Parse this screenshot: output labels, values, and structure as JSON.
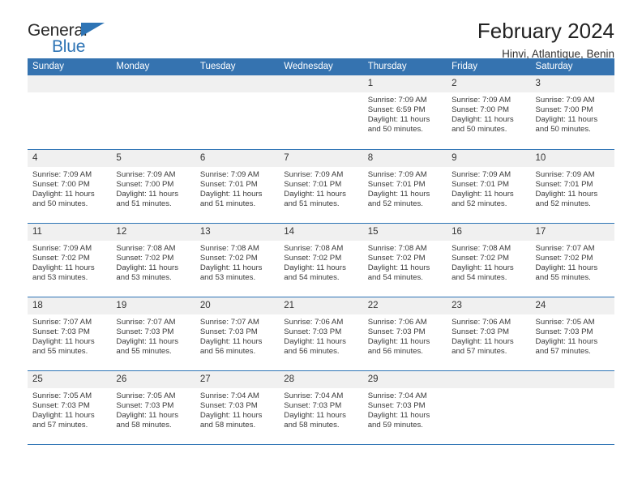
{
  "brand": {
    "name_dark": "General",
    "name_blue": "Blue",
    "accent_color": "#2e74b5"
  },
  "header": {
    "title": "February 2024",
    "location": "Hinvi, Atlantique, Benin",
    "header_bg": "#3573b0",
    "daynum_bg": "#f0f0f0"
  },
  "weekdays": [
    "Sunday",
    "Monday",
    "Tuesday",
    "Wednesday",
    "Thursday",
    "Friday",
    "Saturday"
  ],
  "labels": {
    "sunrise_prefix": "Sunrise:",
    "sunset_prefix": "Sunset:",
    "daylight_prefix": "Daylight:"
  },
  "weeks": [
    [
      {
        "day": ""
      },
      {
        "day": ""
      },
      {
        "day": ""
      },
      {
        "day": ""
      },
      {
        "day": "1",
        "sunrise": "Sunrise: 7:09 AM",
        "sunset": "Sunset: 6:59 PM",
        "daylight": "Daylight: 11 hours and 50 minutes."
      },
      {
        "day": "2",
        "sunrise": "Sunrise: 7:09 AM",
        "sunset": "Sunset: 7:00 PM",
        "daylight": "Daylight: 11 hours and 50 minutes."
      },
      {
        "day": "3",
        "sunrise": "Sunrise: 7:09 AM",
        "sunset": "Sunset: 7:00 PM",
        "daylight": "Daylight: 11 hours and 50 minutes."
      }
    ],
    [
      {
        "day": "4",
        "sunrise": "Sunrise: 7:09 AM",
        "sunset": "Sunset: 7:00 PM",
        "daylight": "Daylight: 11 hours and 50 minutes."
      },
      {
        "day": "5",
        "sunrise": "Sunrise: 7:09 AM",
        "sunset": "Sunset: 7:00 PM",
        "daylight": "Daylight: 11 hours and 51 minutes."
      },
      {
        "day": "6",
        "sunrise": "Sunrise: 7:09 AM",
        "sunset": "Sunset: 7:01 PM",
        "daylight": "Daylight: 11 hours and 51 minutes."
      },
      {
        "day": "7",
        "sunrise": "Sunrise: 7:09 AM",
        "sunset": "Sunset: 7:01 PM",
        "daylight": "Daylight: 11 hours and 51 minutes."
      },
      {
        "day": "8",
        "sunrise": "Sunrise: 7:09 AM",
        "sunset": "Sunset: 7:01 PM",
        "daylight": "Daylight: 11 hours and 52 minutes."
      },
      {
        "day": "9",
        "sunrise": "Sunrise: 7:09 AM",
        "sunset": "Sunset: 7:01 PM",
        "daylight": "Daylight: 11 hours and 52 minutes."
      },
      {
        "day": "10",
        "sunrise": "Sunrise: 7:09 AM",
        "sunset": "Sunset: 7:01 PM",
        "daylight": "Daylight: 11 hours and 52 minutes."
      }
    ],
    [
      {
        "day": "11",
        "sunrise": "Sunrise: 7:09 AM",
        "sunset": "Sunset: 7:02 PM",
        "daylight": "Daylight: 11 hours and 53 minutes."
      },
      {
        "day": "12",
        "sunrise": "Sunrise: 7:08 AM",
        "sunset": "Sunset: 7:02 PM",
        "daylight": "Daylight: 11 hours and 53 minutes."
      },
      {
        "day": "13",
        "sunrise": "Sunrise: 7:08 AM",
        "sunset": "Sunset: 7:02 PM",
        "daylight": "Daylight: 11 hours and 53 minutes."
      },
      {
        "day": "14",
        "sunrise": "Sunrise: 7:08 AM",
        "sunset": "Sunset: 7:02 PM",
        "daylight": "Daylight: 11 hours and 54 minutes."
      },
      {
        "day": "15",
        "sunrise": "Sunrise: 7:08 AM",
        "sunset": "Sunset: 7:02 PM",
        "daylight": "Daylight: 11 hours and 54 minutes."
      },
      {
        "day": "16",
        "sunrise": "Sunrise: 7:08 AM",
        "sunset": "Sunset: 7:02 PM",
        "daylight": "Daylight: 11 hours and 54 minutes."
      },
      {
        "day": "17",
        "sunrise": "Sunrise: 7:07 AM",
        "sunset": "Sunset: 7:02 PM",
        "daylight": "Daylight: 11 hours and 55 minutes."
      }
    ],
    [
      {
        "day": "18",
        "sunrise": "Sunrise: 7:07 AM",
        "sunset": "Sunset: 7:03 PM",
        "daylight": "Daylight: 11 hours and 55 minutes."
      },
      {
        "day": "19",
        "sunrise": "Sunrise: 7:07 AM",
        "sunset": "Sunset: 7:03 PM",
        "daylight": "Daylight: 11 hours and 55 minutes."
      },
      {
        "day": "20",
        "sunrise": "Sunrise: 7:07 AM",
        "sunset": "Sunset: 7:03 PM",
        "daylight": "Daylight: 11 hours and 56 minutes."
      },
      {
        "day": "21",
        "sunrise": "Sunrise: 7:06 AM",
        "sunset": "Sunset: 7:03 PM",
        "daylight": "Daylight: 11 hours and 56 minutes."
      },
      {
        "day": "22",
        "sunrise": "Sunrise: 7:06 AM",
        "sunset": "Sunset: 7:03 PM",
        "daylight": "Daylight: 11 hours and 56 minutes."
      },
      {
        "day": "23",
        "sunrise": "Sunrise: 7:06 AM",
        "sunset": "Sunset: 7:03 PM",
        "daylight": "Daylight: 11 hours and 57 minutes."
      },
      {
        "day": "24",
        "sunrise": "Sunrise: 7:05 AM",
        "sunset": "Sunset: 7:03 PM",
        "daylight": "Daylight: 11 hours and 57 minutes."
      }
    ],
    [
      {
        "day": "25",
        "sunrise": "Sunrise: 7:05 AM",
        "sunset": "Sunset: 7:03 PM",
        "daylight": "Daylight: 11 hours and 57 minutes."
      },
      {
        "day": "26",
        "sunrise": "Sunrise: 7:05 AM",
        "sunset": "Sunset: 7:03 PM",
        "daylight": "Daylight: 11 hours and 58 minutes."
      },
      {
        "day": "27",
        "sunrise": "Sunrise: 7:04 AM",
        "sunset": "Sunset: 7:03 PM",
        "daylight": "Daylight: 11 hours and 58 minutes."
      },
      {
        "day": "28",
        "sunrise": "Sunrise: 7:04 AM",
        "sunset": "Sunset: 7:03 PM",
        "daylight": "Daylight: 11 hours and 58 minutes."
      },
      {
        "day": "29",
        "sunrise": "Sunrise: 7:04 AM",
        "sunset": "Sunset: 7:03 PM",
        "daylight": "Daylight: 11 hours and 59 minutes."
      },
      {
        "day": ""
      },
      {
        "day": ""
      }
    ]
  ]
}
